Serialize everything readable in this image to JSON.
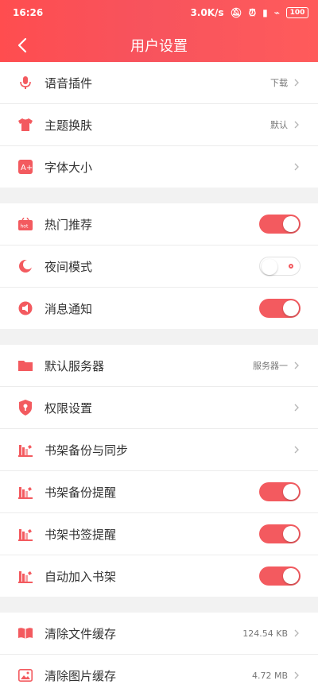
{
  "status_bar": {
    "time": "16:26",
    "net_speed": "3.0K/s",
    "battery": "100"
  },
  "header": {
    "title": "用户设置"
  },
  "colors": {
    "accent": "#f35a5f"
  },
  "sections": [
    {
      "rows": [
        {
          "label": "语音插件",
          "value": "下载",
          "type": "link",
          "icon": "microphone-icon"
        },
        {
          "label": "主题换肤",
          "value": "默认",
          "type": "link",
          "icon": "tshirt-icon"
        },
        {
          "label": "字体大小",
          "value": "",
          "type": "link",
          "icon": "font-size-icon"
        }
      ]
    },
    {
      "rows": [
        {
          "label": "热门推荐",
          "type": "toggle",
          "on": true,
          "icon": "hot-badge-icon"
        },
        {
          "label": "夜间模式",
          "type": "toggle",
          "on": false,
          "icon": "moon-icon"
        },
        {
          "label": "消息通知",
          "type": "toggle",
          "on": true,
          "icon": "megaphone-icon"
        }
      ]
    },
    {
      "rows": [
        {
          "label": "默认服务器",
          "value": "服务器一",
          "type": "link",
          "icon": "folder-icon"
        },
        {
          "label": "权限设置",
          "value": "",
          "type": "link",
          "icon": "shield-key-icon"
        },
        {
          "label": "书架备份与同步",
          "value": "",
          "type": "link",
          "icon": "bookshelf-icon"
        },
        {
          "label": "书架备份提醒",
          "type": "toggle",
          "on": true,
          "icon": "bookshelf-icon"
        },
        {
          "label": "书架书签提醒",
          "type": "toggle",
          "on": true,
          "icon": "bookshelf-icon"
        },
        {
          "label": "自动加入书架",
          "type": "toggle",
          "on": true,
          "icon": "bookshelf-icon"
        }
      ]
    },
    {
      "rows": [
        {
          "label": "清除文件缓存",
          "value": "124.54 KB",
          "type": "link",
          "icon": "open-book-icon"
        },
        {
          "label": "清除图片缓存",
          "value": "4.72 MB",
          "type": "link",
          "icon": "image-icon"
        }
      ]
    }
  ]
}
